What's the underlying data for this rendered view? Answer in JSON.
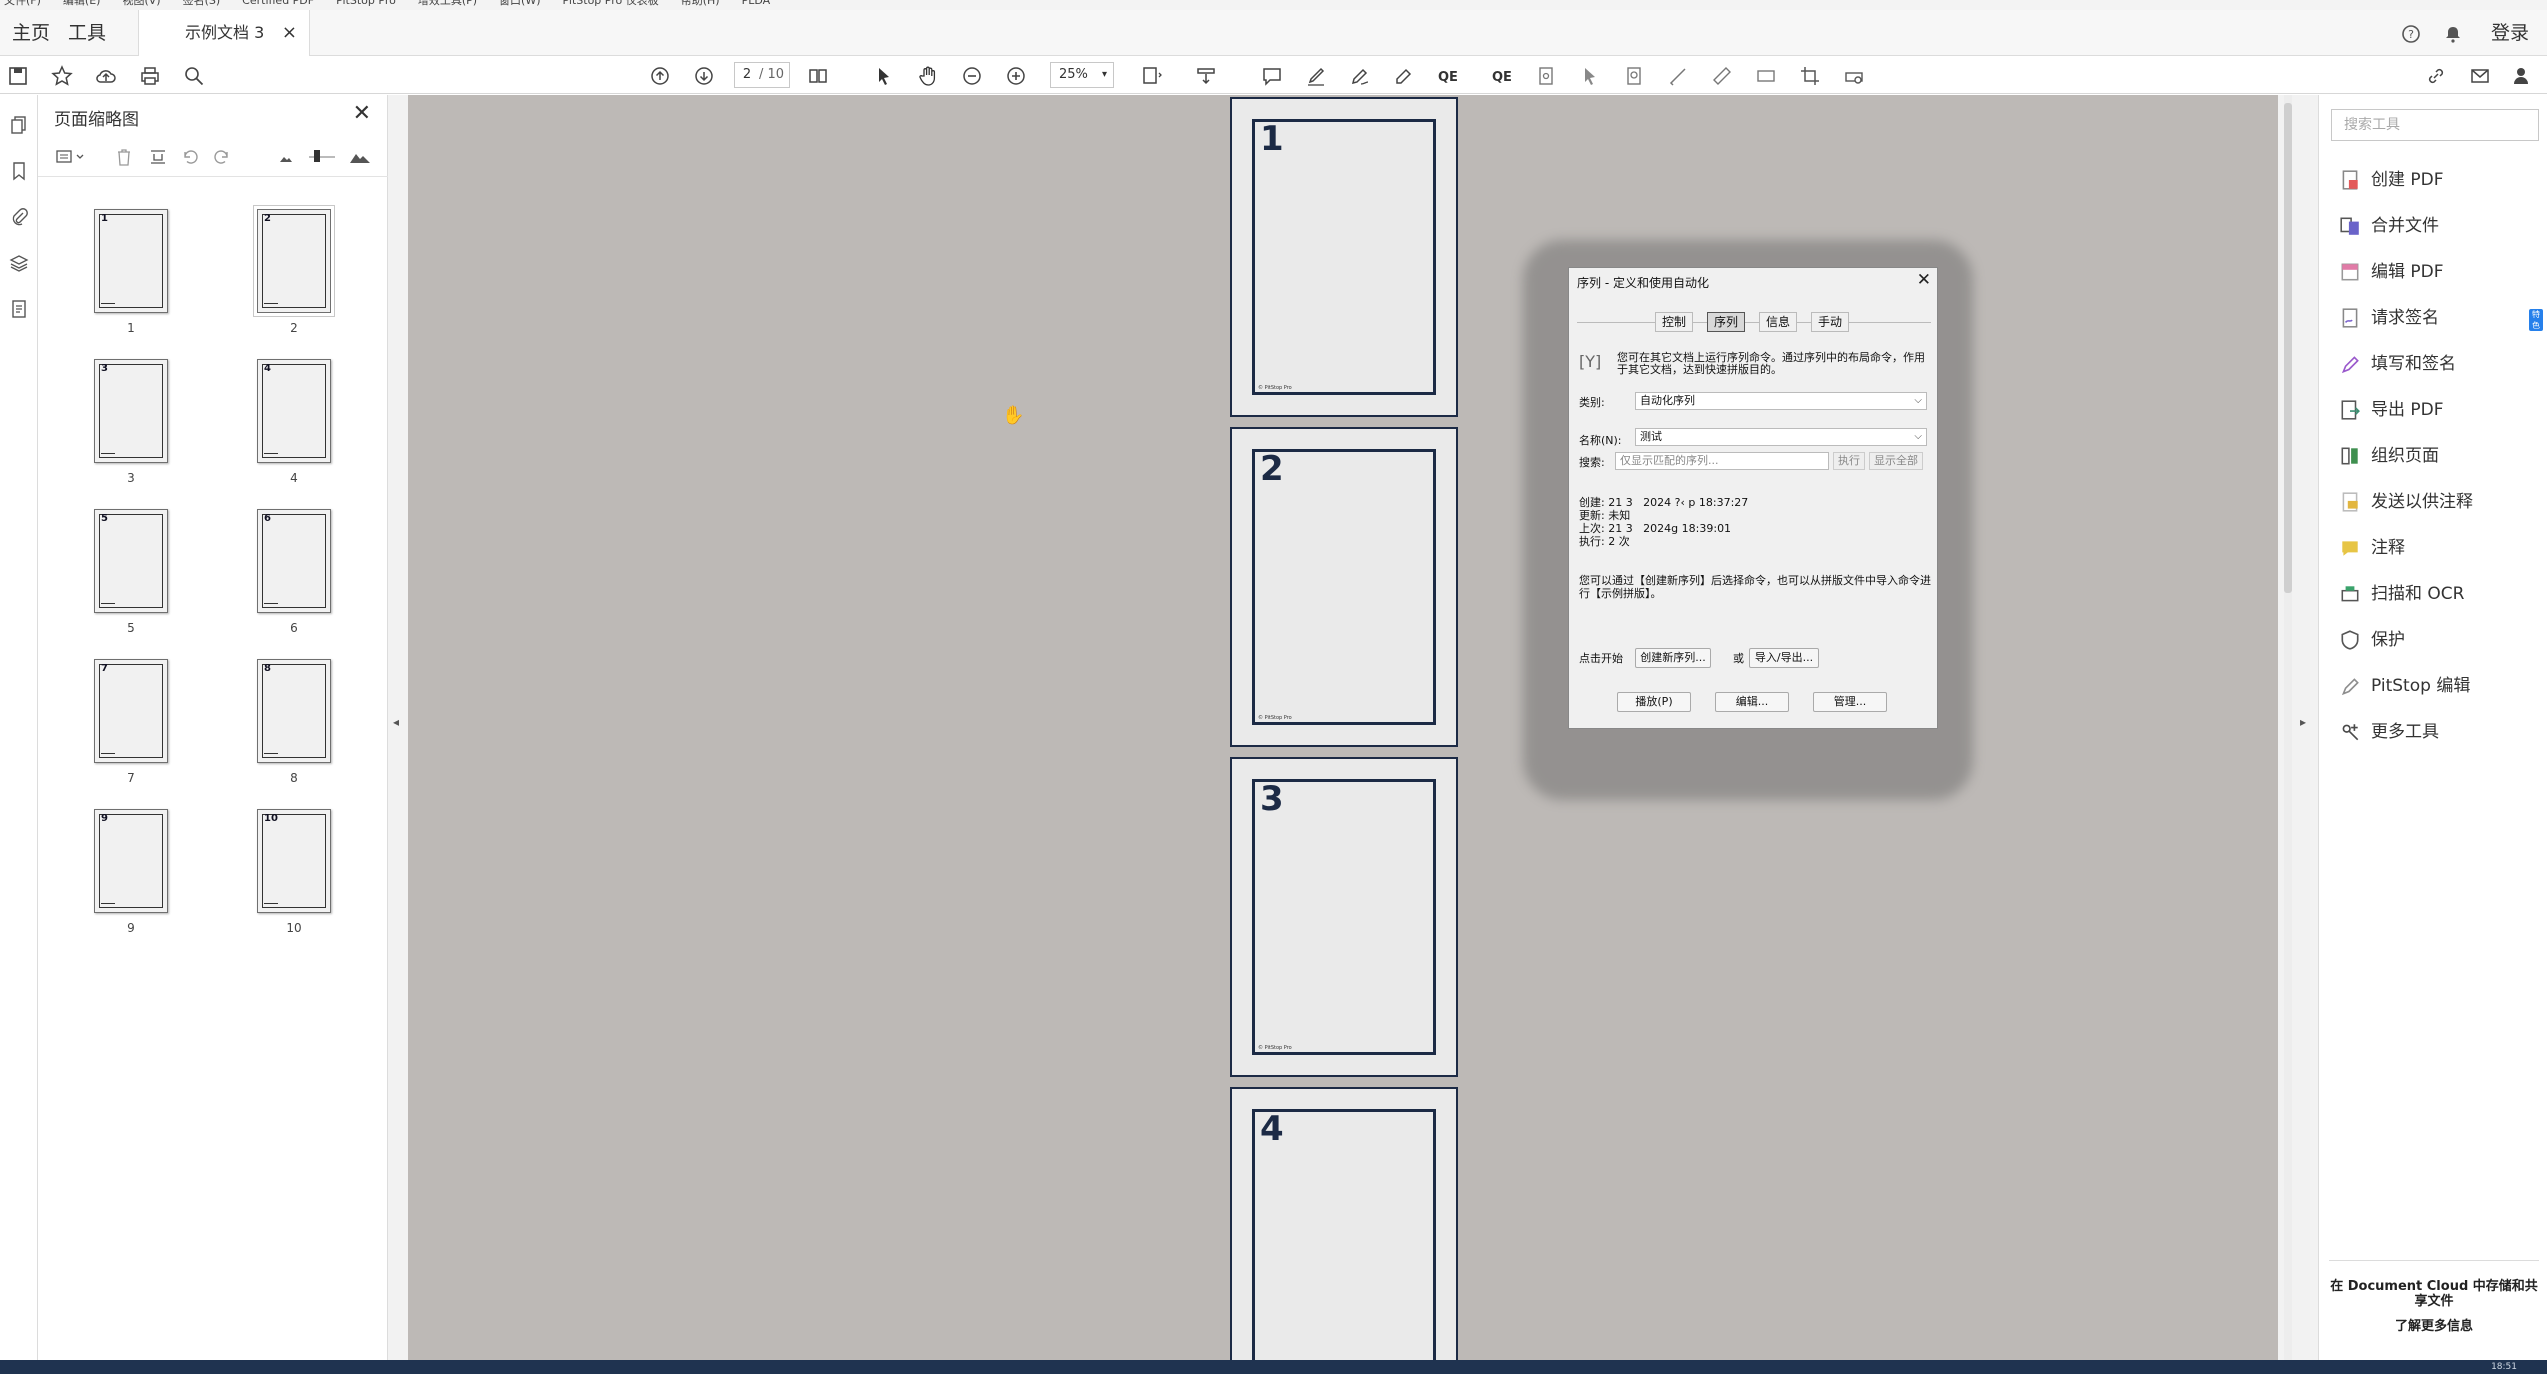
{
  "menu": [
    "文件(F)",
    "编辑(E)",
    "视图(V)",
    "签名(S)",
    "Certified PDF",
    "PitStop Pro",
    "增效工具(P)",
    "窗口(W)",
    "PitStop Pro 仪表板",
    "帮助(H)",
    "PLDA"
  ],
  "tabs": {
    "home": "主页",
    "tools": "工具",
    "doc": "示例文档 3",
    "close": "×"
  },
  "header": {
    "login": "登录"
  },
  "toolbar": {
    "page_current": "2",
    "page_total": "/ 10",
    "zoom": "25%"
  },
  "thumb_panel": {
    "title": "页面缩略图",
    "close": "✕",
    "pages": [
      {
        "num": "1",
        "label": "1"
      },
      {
        "num": "2",
        "label": "2"
      },
      {
        "num": "3",
        "label": "3"
      },
      {
        "num": "4",
        "label": "4"
      },
      {
        "num": "5",
        "label": "5"
      },
      {
        "num": "6",
        "label": "6"
      },
      {
        "num": "7",
        "label": "7"
      },
      {
        "num": "8",
        "label": "8"
      },
      {
        "num": "9",
        "label": "9"
      },
      {
        "num": "10",
        "label": "10"
      }
    ],
    "selected": "2"
  },
  "document": {
    "pages": [
      {
        "num": "1"
      },
      {
        "num": "2"
      },
      {
        "num": "3"
      },
      {
        "num": "4"
      }
    ],
    "footer_text": "© PitStop Pro"
  },
  "dialog": {
    "title": "序列 - 定义和使用自动化",
    "close": "✕",
    "tabs": [
      "控制",
      "序列",
      "信息",
      "手动"
    ],
    "active_tab": "序列",
    "icon": "[Y]",
    "description": "您可在其它文档上运行序列命令。通过序列中的布局命令，作用于其它文档，达到快速拼版目的。",
    "category_label": "类别:",
    "category_value": "自动化序列",
    "name_label": "名称(N):",
    "name_value": "测试",
    "search_label": "搜索:",
    "search_placeholder": "仅显示匹配的序列...",
    "run_label": "执行",
    "show_all_label": "显示全部",
    "info": "创建: 21 3   2024 ?‹ p 18:37:27\n更新: 未知\n上次: 21 3   2024g 18:39:01\n执行: 2 次",
    "note": "您可以通过【创建新序列】后选择命令，也可以从拼版文件中导入命令进行【示例拼版】。",
    "start_label": "点击开始",
    "create_btn": "创建新序列...",
    "or_label": "或",
    "import_btn": "导入/导出...",
    "play_btn": "播放(P)",
    "edit_btn": "编辑...",
    "manage_btn": "管理..."
  },
  "right_pane": {
    "search_placeholder": "搜索工具",
    "items": [
      {
        "label": "创建 PDF",
        "icon": "create-pdf-icon",
        "color": "#e35a5a"
      },
      {
        "label": "合并文件",
        "icon": "combine-files-icon",
        "color": "#6a63c9"
      },
      {
        "label": "编辑 PDF",
        "icon": "edit-pdf-icon",
        "color": "#e17ba7"
      },
      {
        "label": "请求签名",
        "icon": "request-signature-icon",
        "color": "#7a62cc"
      },
      {
        "label": "填写和签名",
        "icon": "fill-sign-icon",
        "color": "#9a59cc"
      },
      {
        "label": "导出 PDF",
        "icon": "export-pdf-icon",
        "color": "#3d8f72"
      },
      {
        "label": "组织页面",
        "icon": "organize-pages-icon",
        "color": "#3f8f4f"
      },
      {
        "label": "发送以供注释",
        "icon": "send-comment-icon",
        "color": "#e2b640"
      },
      {
        "label": "注释",
        "icon": "comment-icon",
        "color": "#e7c545"
      },
      {
        "label": "扫描和 OCR",
        "icon": "scan-ocr-icon",
        "color": "#3aa36b"
      },
      {
        "label": "保护",
        "icon": "protect-icon",
        "color": "#7a55c0"
      },
      {
        "label": "PitStop 编辑",
        "icon": "pitstop-edit-icon",
        "color": "#8e8e8e"
      },
      {
        "label": "更多工具",
        "icon": "more-tools-icon",
        "color": "#4a4a4a"
      }
    ],
    "badge": "特色",
    "footer": "在 Document Cloud 中存储和共享文件",
    "learn_more": "了解更多信息"
  },
  "taskbar": {
    "time": "18:51"
  }
}
